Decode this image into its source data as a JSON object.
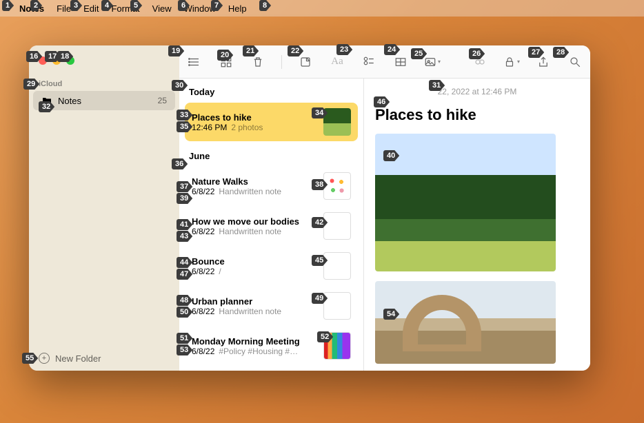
{
  "menubar": {
    "app": "Notes",
    "items": [
      "File",
      "Edit",
      "Format",
      "View",
      "Window",
      "Help"
    ]
  },
  "sidebar": {
    "section": "iCloud",
    "folder": {
      "name": "Notes",
      "count": "25"
    },
    "newFolder": "New Folder"
  },
  "list": {
    "groups": [
      {
        "header": "Today",
        "notes": [
          {
            "title": "Places to hike",
            "date": "12:46 PM",
            "preview": "2 photos",
            "thumb": "t0"
          }
        ]
      },
      {
        "header": "June",
        "notes": [
          {
            "title": "Nature Walks",
            "date": "6/8/22",
            "preview": "Handwritten note",
            "thumb": "t1"
          },
          {
            "title": "How we move our bodies",
            "date": "6/8/22",
            "preview": "Handwritten note",
            "thumb": "t2"
          },
          {
            "title": "Bounce",
            "date": "6/8/22",
            "preview": "/",
            "thumb": "t3"
          },
          {
            "title": "Urban planner",
            "date": "6/8/22",
            "preview": "Handwritten note",
            "thumb": "t4"
          },
          {
            "title": "Monday Morning Meeting",
            "date": "6/8/22",
            "preview": "#Policy #Housing #…",
            "thumb": "t5"
          }
        ]
      }
    ]
  },
  "editor": {
    "datetime": "22, 2022 at 12:46 PM",
    "title": "Places to hike"
  },
  "toolbar": {
    "names": [
      "list-view-icon",
      "gallery-view-icon",
      "trash-icon",
      "new-note-icon",
      "format-icon",
      "checklist-icon",
      "table-icon",
      "media-icon",
      "link-icon",
      "lock-icon",
      "share-icon",
      "search-icon"
    ]
  },
  "markers": [
    [
      1,
      3,
      0
    ],
    [
      2,
      44,
      0
    ],
    [
      3,
      102,
      0
    ],
    [
      4,
      147,
      0
    ],
    [
      5,
      189,
      0
    ],
    [
      6,
      258,
      0
    ],
    [
      7,
      306,
      0
    ],
    [
      8,
      376,
      0
    ],
    [
      16,
      38,
      74
    ],
    [
      17,
      65,
      74
    ],
    [
      18,
      83,
      74
    ],
    [
      19,
      244,
      66
    ],
    [
      20,
      315,
      72
    ],
    [
      21,
      352,
      66
    ],
    [
      22,
      417,
      66
    ],
    [
      23,
      488,
      64
    ],
    [
      24,
      557,
      64
    ],
    [
      25,
      596,
      70
    ],
    [
      26,
      680,
      70
    ],
    [
      27,
      766,
      68
    ],
    [
      28,
      802,
      68
    ],
    [
      29,
      34,
      114
    ],
    [
      30,
      249,
      116
    ],
    [
      31,
      622,
      116
    ],
    [
      32,
      56,
      147
    ],
    [
      33,
      256,
      159
    ],
    [
      34,
      452,
      156
    ],
    [
      35,
      256,
      176
    ],
    [
      36,
      249,
      230
    ],
    [
      37,
      256,
      263
    ],
    [
      38,
      452,
      260
    ],
    [
      39,
      256,
      280
    ],
    [
      41,
      256,
      318
    ],
    [
      42,
      452,
      315
    ],
    [
      43,
      256,
      335
    ],
    [
      44,
      256,
      373
    ],
    [
      45,
      452,
      370
    ],
    [
      47,
      256,
      390
    ],
    [
      46,
      542,
      140
    ],
    [
      40,
      556,
      218
    ],
    [
      48,
      256,
      428
    ],
    [
      49,
      452,
      425
    ],
    [
      50,
      256,
      445
    ],
    [
      51,
      256,
      483
    ],
    [
      52,
      460,
      481
    ],
    [
      53,
      256,
      500
    ],
    [
      54,
      556,
      448
    ],
    [
      55,
      32,
      512
    ]
  ]
}
